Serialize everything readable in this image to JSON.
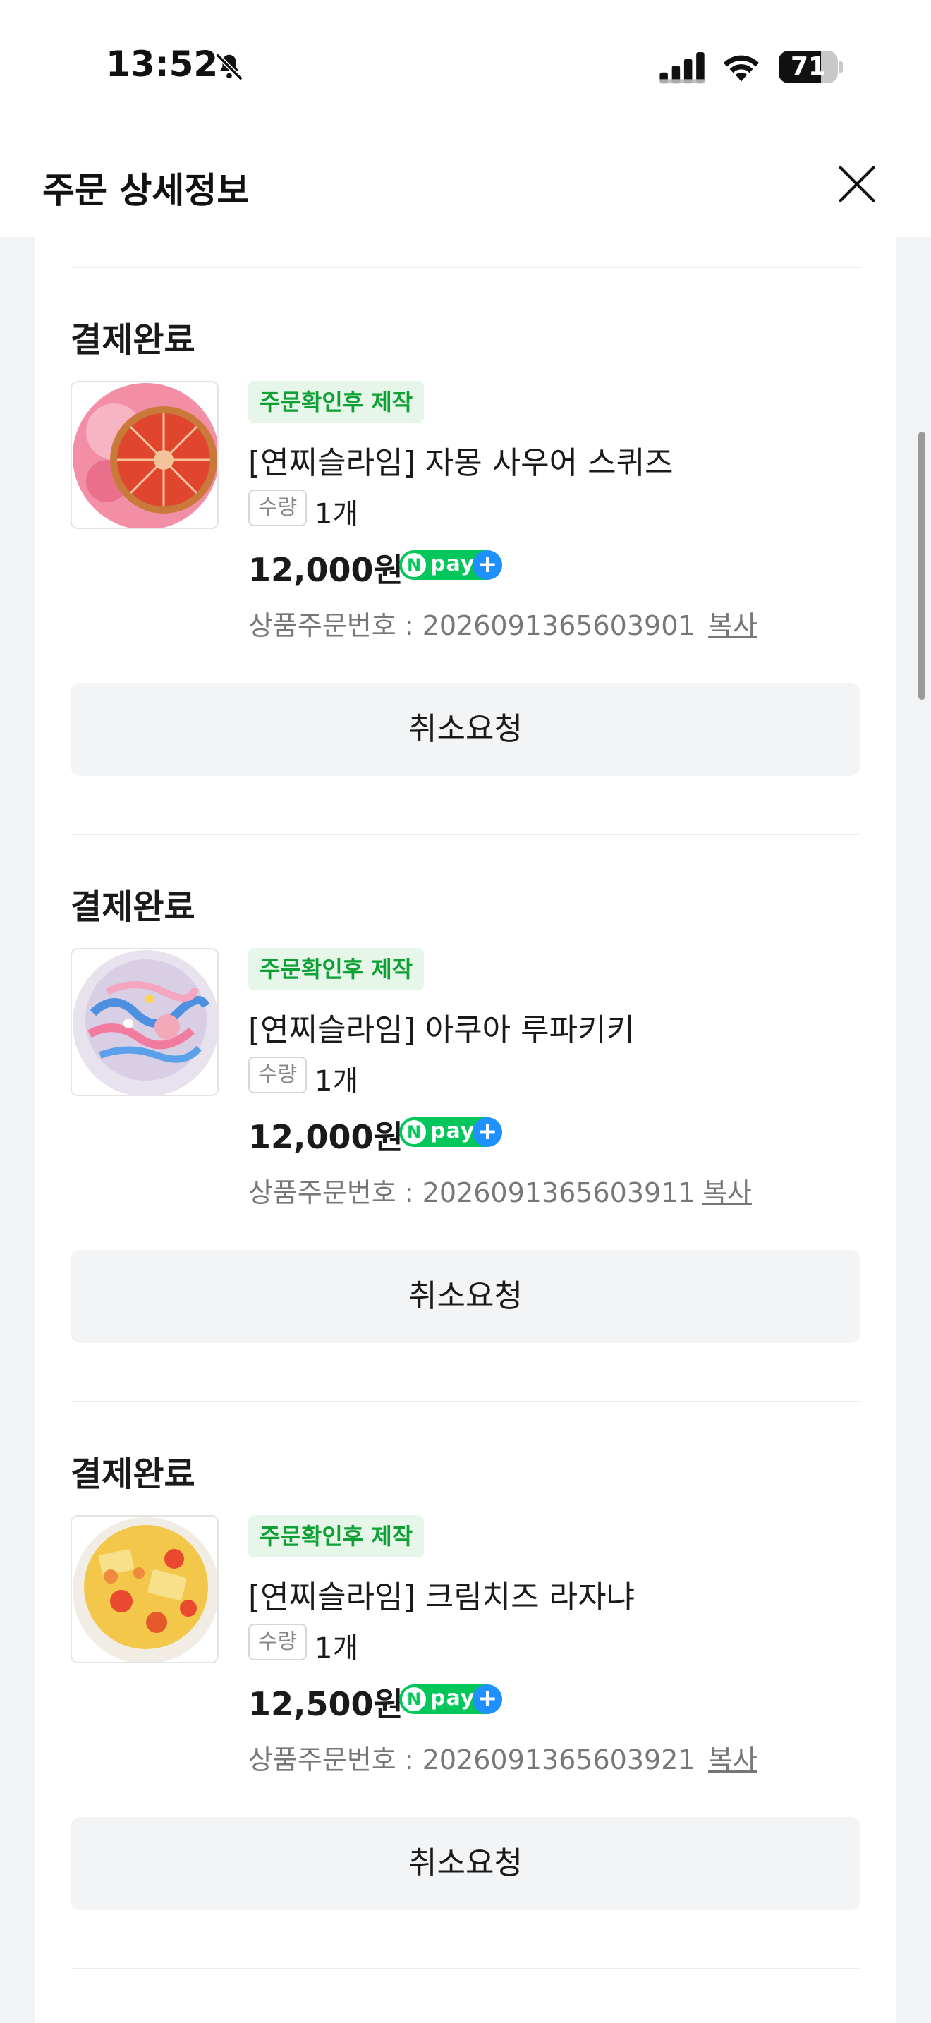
{
  "status_bar": {
    "time": "13:52",
    "battery_percent": 71,
    "battery_label": "71"
  },
  "header": {
    "title": "주문 상세정보"
  },
  "orders": [
    {
      "status": "결제완료",
      "badge": "주문확인후 제작",
      "product_name": "[연찌슬라임] 자몽 사우어 스퀴즈",
      "qty_label": "수량",
      "qty_value": "1개",
      "price": "12,000원",
      "order_no": "상품주문번호 : 2026091365603901",
      "copy_label": "복사",
      "cancel_label": "취소요청"
    },
    {
      "status": "결제완료",
      "badge": "주문확인후 제작",
      "product_name": "[연찌슬라임] 아쿠아 루파키키",
      "qty_label": "수량",
      "qty_value": "1개",
      "price": "12,000원",
      "order_no": "상품주문번호 : 2026091365603911",
      "copy_label": "복사",
      "cancel_label": "취소요청"
    },
    {
      "status": "결제완료",
      "badge": "주문확인후 제작",
      "product_name": "[연찌슬라임] 크림치즈 라자냐",
      "qty_label": "수량",
      "qty_value": "1개",
      "price": "12,500원",
      "order_no": "상품주문번호 : 2026091365603921",
      "copy_label": "복사",
      "cancel_label": "취소요청"
    }
  ],
  "npay": {
    "n": "N",
    "text": "pay",
    "plus": "+"
  },
  "colors": {
    "badge_text": "#0e9f35",
    "badge_bg": "#e6f7e9",
    "npay_green": "#03c75a",
    "npay_blue": "#1e90ff",
    "button_bg": "#f3f4f6"
  }
}
